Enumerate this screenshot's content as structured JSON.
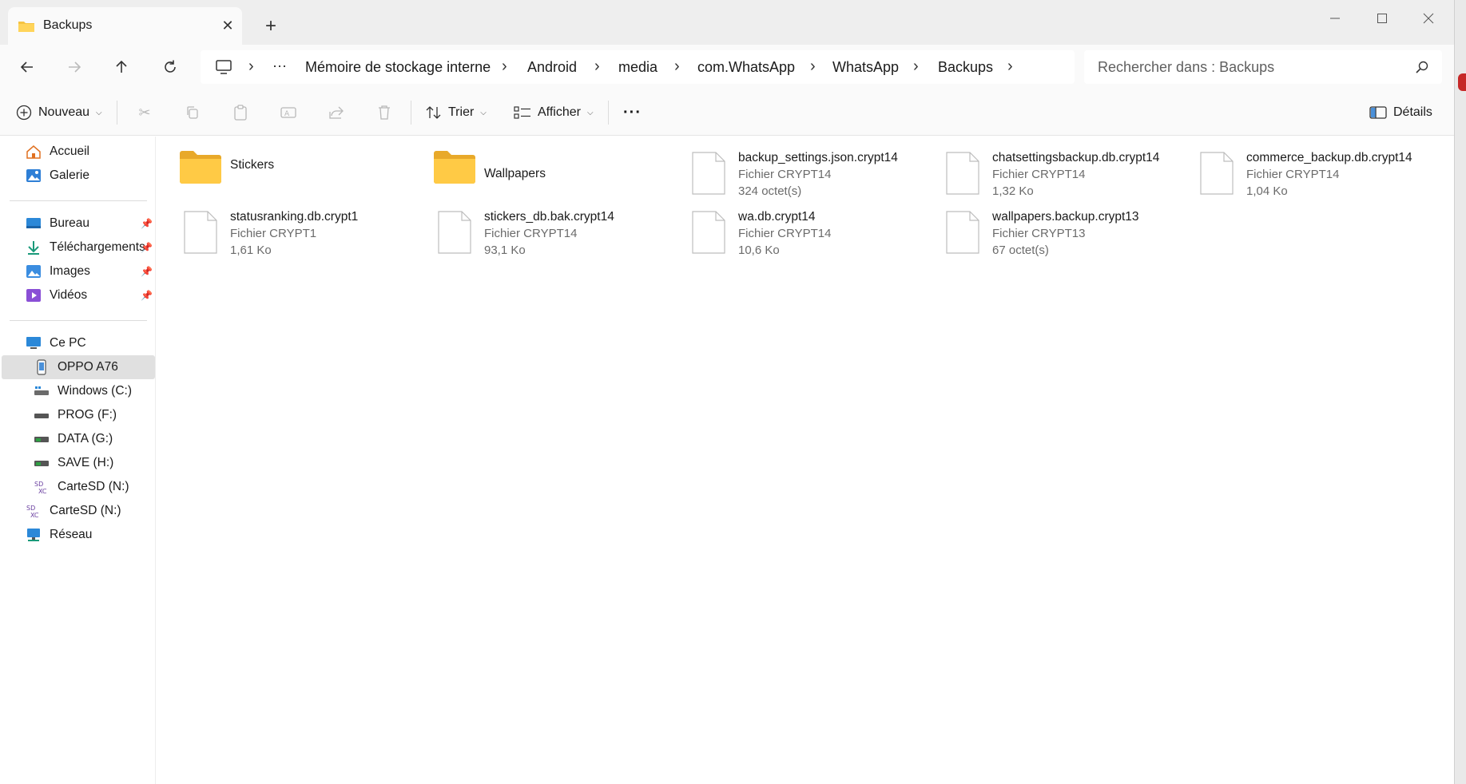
{
  "window": {
    "tab_title": "Backups",
    "new_tab_symbol": "+",
    "close_symbol": "✕"
  },
  "breadcrumb": {
    "more": "···",
    "items": [
      "Mémoire de stockage interne",
      "Android",
      "media",
      "com.WhatsApp",
      "WhatsApp",
      "Backups"
    ]
  },
  "search": {
    "placeholder": "Rechercher dans : Backups"
  },
  "toolbar": {
    "new_label": "Nouveau",
    "sort_label": "Trier",
    "view_label": "Afficher",
    "more_symbol": "···",
    "details_label": "Détails"
  },
  "sidebar": {
    "quick": [
      {
        "label": "Accueil",
        "icon": "home-icon"
      },
      {
        "label": "Galerie",
        "icon": "gallery-icon"
      }
    ],
    "pinned": [
      {
        "label": "Bureau",
        "icon": "desktop-icon"
      },
      {
        "label": "Téléchargements",
        "icon": "download-icon"
      },
      {
        "label": "Images",
        "icon": "images-icon"
      },
      {
        "label": "Vidéos",
        "icon": "videos-icon"
      }
    ],
    "this_pc": "Ce PC",
    "drives": [
      {
        "label": "OPPO A76",
        "icon": "phone-icon",
        "selected": true
      },
      {
        "label": "Windows (C:)",
        "icon": "drive-icon"
      },
      {
        "label": "PROG (F:)",
        "icon": "drive-icon"
      },
      {
        "label": "DATA (G:)",
        "icon": "drive-icon"
      },
      {
        "label": "SAVE (H:)",
        "icon": "drive-icon"
      },
      {
        "label": "CarteSD (N:)",
        "icon": "sd-card-icon"
      }
    ],
    "root_items": [
      {
        "label": "CarteSD (N:)",
        "icon": "sd-card-icon"
      },
      {
        "label": "Réseau",
        "icon": "network-icon"
      }
    ]
  },
  "files": [
    {
      "name": "Stickers",
      "kind": "folder"
    },
    {
      "name": "Wallpapers",
      "kind": "folder"
    },
    {
      "name": "backup_settings.json.crypt14",
      "kind": "file",
      "type": "Fichier CRYPT14",
      "size": "324 octet(s)"
    },
    {
      "name": "chatsettingsbackup.db.crypt14",
      "kind": "file",
      "type": "Fichier CRYPT14",
      "size": "1,32 Ko"
    },
    {
      "name": "commerce_backup.db.crypt14",
      "kind": "file",
      "type": "Fichier CRYPT14",
      "size": "1,04 Ko"
    },
    {
      "name": "statusranking.db.crypt1",
      "kind": "file",
      "type": "Fichier CRYPT1",
      "size": "1,61 Ko"
    },
    {
      "name": "stickers_db.bak.crypt14",
      "kind": "file",
      "type": "Fichier CRYPT14",
      "size": "93,1 Ko"
    },
    {
      "name": "wa.db.crypt14",
      "kind": "file",
      "type": "Fichier CRYPT14",
      "size": "10,6 Ko"
    },
    {
      "name": "wallpapers.backup.crypt13",
      "kind": "file",
      "type": "Fichier CRYPT13",
      "size": "67 octet(s)"
    }
  ],
  "colors": {
    "folder": "#f5c342",
    "accent": "#0067c0",
    "selected_bg": "#e0e0e0"
  }
}
